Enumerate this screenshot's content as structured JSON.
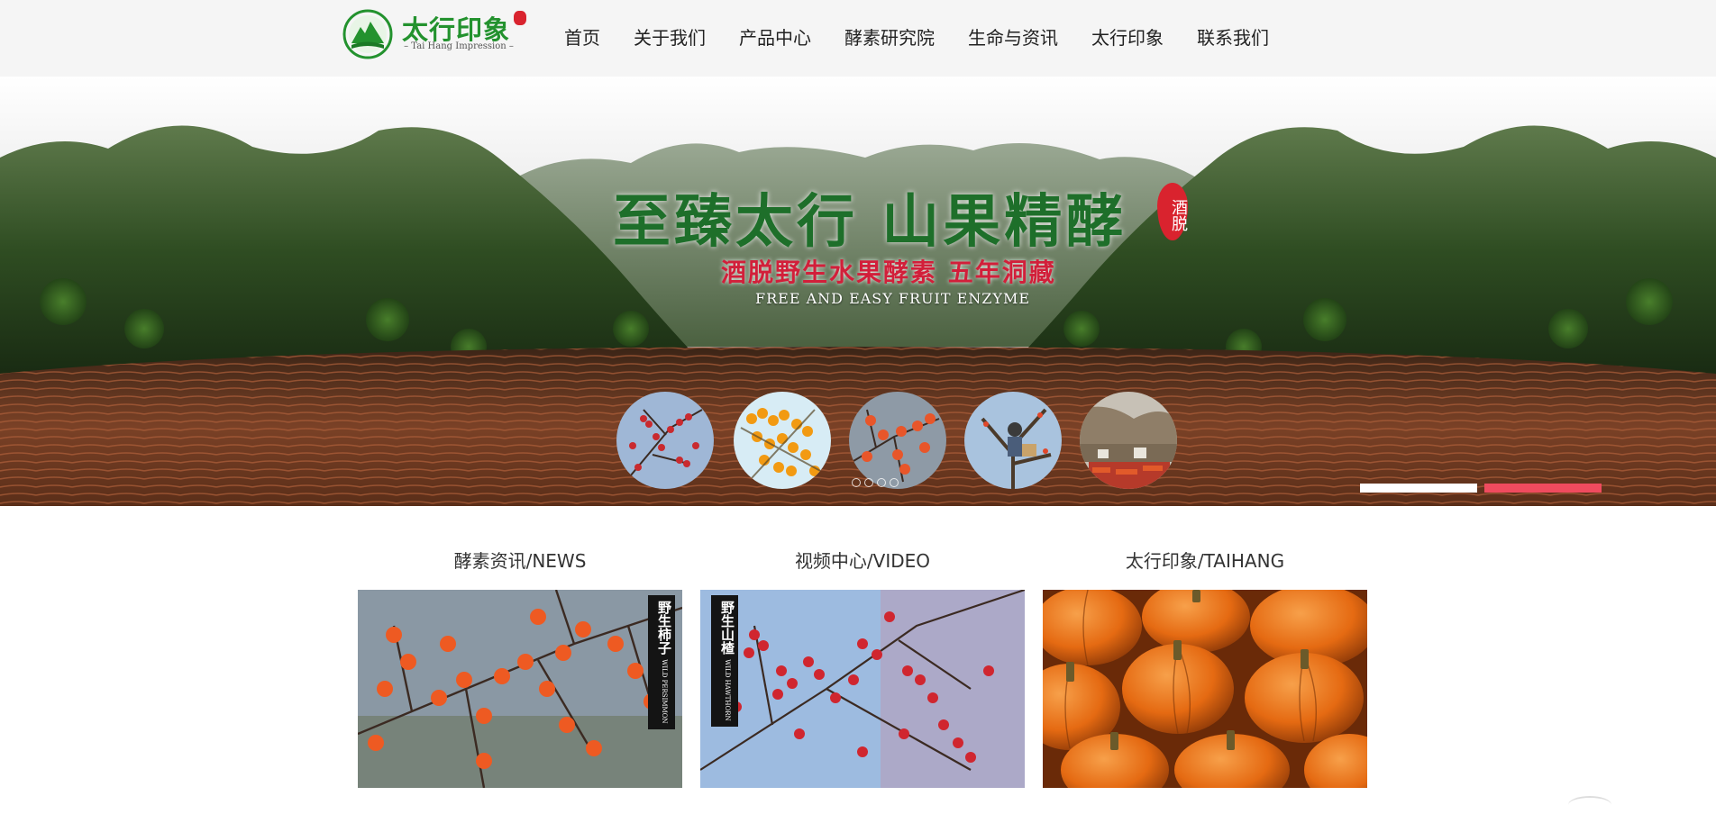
{
  "logo": {
    "title": "太行印象",
    "subtitle": "– Tai Hang Impression –"
  },
  "nav": {
    "items": [
      {
        "label": "首页",
        "icon": "home"
      },
      {
        "label": "关于我们"
      },
      {
        "label": "产品中心"
      },
      {
        "label": "酵素研究院"
      },
      {
        "label": "生命与资讯"
      },
      {
        "label": "太行印象"
      },
      {
        "label": "联系我们"
      }
    ]
  },
  "hero": {
    "title": "至臻太行 山果精酵",
    "badge": "酒脱",
    "subtitle": "酒脱野生水果酵素 五年洞藏",
    "subtitle_en": "FREE AND EASY FRUIT ENZYME",
    "thumbnails": [
      "wild-hawthorn-branch",
      "sea-buckthorn-berries",
      "persimmon-branch",
      "fruit-picker-in-tree",
      "cliff-village-drying-fruit"
    ],
    "active_slide": 1,
    "slide_count": 2
  },
  "sections": [
    {
      "title": "酵素资讯/NEWS",
      "image": "wild-persimmon",
      "tag": "野生柿子",
      "tag_en": "WILD PERSIMMON"
    },
    {
      "title": "视频中心/VIDEO",
      "image": "wild-hawthorn",
      "tag": "野生山楂",
      "tag_en": "WILD HAWTHORN"
    },
    {
      "title": "太行印象/TAIHANG",
      "image": "pumpkins",
      "tag": "",
      "tag_en": ""
    }
  ],
  "colors": {
    "header_bg": "#f5f5f5",
    "brand_green": "#23922e",
    "hero_title": "#1e6f2a",
    "hero_sub": "#d21f3a",
    "slide_active": "#ef4b5e",
    "slide_inactive": "#ffffff"
  }
}
